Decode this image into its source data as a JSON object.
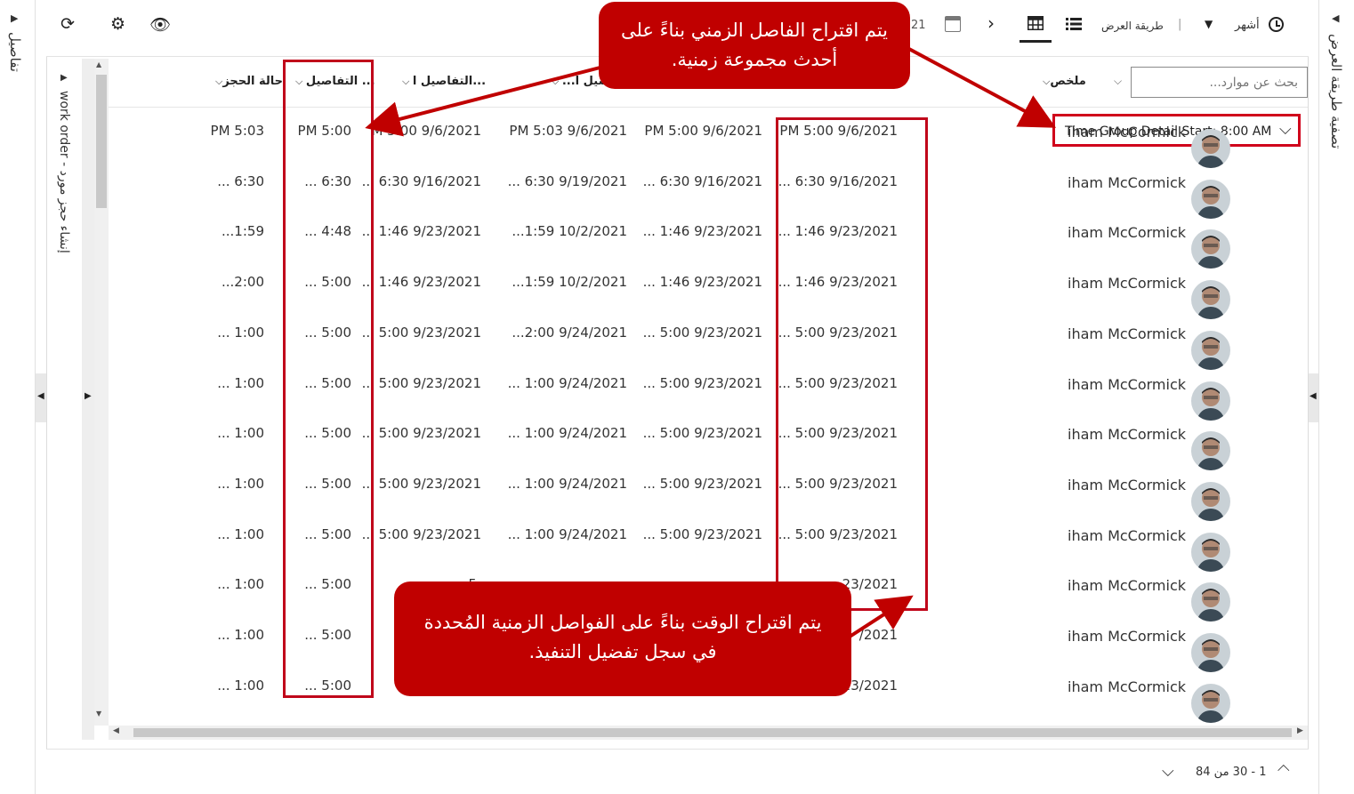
{
  "left_pane": {
    "label": "تفاصيل"
  },
  "right_pane": {
    "label": "تصفية طريقة العرض"
  },
  "strip": {
    "label": "work order - إنشاء حجز مورد"
  },
  "toolbar": {
    "period_label": "أشهر",
    "view_mode_label": "طريقة العرض",
    "separator": "|",
    "date_fragment": "21"
  },
  "search": {
    "placeholder": "بحث عن موارد..."
  },
  "summary_label": "ملخص",
  "time_group": {
    "label": "Time Group Detail Start: 8:00 AM"
  },
  "columns": {
    "status": "حالة الحجز",
    "details_a": "التفاصيل ...",
    "details_b": "التفاصيل ا...",
    "details_c": "...صيل ا"
  },
  "resource_name": "iham McCormick",
  "rows": [
    {
      "status": "PM 5:03",
      "d1": "PM 5:00",
      "d2": "M 5:00 9/6/2021",
      "d3": "PM 5:03 9/6/2021",
      "d4": "PM 5:00 9/6/2021",
      "d5": "PM 5:00 9/6/2021"
    },
    {
      "status": "... 6:30",
      "d1": "... 6:30",
      "d2": "... 6:30 9/16/2021",
      "d3": "... 6:30 9/19/2021",
      "d4": "... 6:30 9/16/2021",
      "d5": "... 6:30 9/16/2021"
    },
    {
      "status": "...1:59",
      "d1": "... 4:48",
      "d2": "... 1:46 9/23/2021",
      "d3": "...1:59 10/2/2021",
      "d4": "... 1:46 9/23/2021",
      "d5": "... 1:46 9/23/2021"
    },
    {
      "status": "...2:00",
      "d1": "... 5:00",
      "d2": "... 1:46 9/23/2021",
      "d3": "...1:59 10/2/2021",
      "d4": "... 1:46 9/23/2021",
      "d5": "... 1:46 9/23/2021"
    },
    {
      "status": "... 1:00",
      "d1": "... 5:00",
      "d2": "... 5:00 9/23/2021",
      "d3": "...2:00 9/24/2021",
      "d4": "... 5:00 9/23/2021",
      "d5": "... 5:00 9/23/2021"
    },
    {
      "status": "... 1:00",
      "d1": "... 5:00",
      "d2": "... 5:00 9/23/2021",
      "d3": "... 1:00 9/24/2021",
      "d4": "... 5:00 9/23/2021",
      "d5": "... 5:00 9/23/2021"
    },
    {
      "status": "... 1:00",
      "d1": "... 5:00",
      "d2": "... 5:00 9/23/2021",
      "d3": "... 1:00 9/24/2021",
      "d4": "... 5:00 9/23/2021",
      "d5": "... 5:00 9/23/2021"
    },
    {
      "status": "... 1:00",
      "d1": "... 5:00",
      "d2": "... 5:00 9/23/2021",
      "d3": "... 1:00 9/24/2021",
      "d4": "... 5:00 9/23/2021",
      "d5": "... 5:00 9/23/2021"
    },
    {
      "status": "... 1:00",
      "d1": "... 5:00",
      "d2": "... 5:00 9/23/2021",
      "d3": "... 1:00 9/24/2021",
      "d4": "... 5:00 9/23/2021",
      "d5": "... 5:00 9/23/2021"
    },
    {
      "status": "... 1:00",
      "d1": "... 5:00",
      "d2": "5:",
      "d3": "",
      "d4": "",
      "d5": "...23/2021"
    },
    {
      "status": "... 1:00",
      "d1": "... 5:00",
      "d2": "5",
      "d3": "",
      "d4": "",
      "d5": "/2021"
    },
    {
      "status": "... 1:00",
      "d1": "... 5:00",
      "d2": "5",
      "d3": "",
      "d4": "",
      "d5": "23/2021"
    }
  ],
  "callouts": {
    "top": "يتم اقتراح الفاصل الزمني بناءً على أحدث مجموعة زمنية.",
    "bottom": "يتم اقتراح الوقت بناءً على الفواصل الزمنية المُحددة في سجل تفضيل التنفيذ."
  },
  "footer": {
    "pager": "1 - 30 من 84"
  },
  "colors": {
    "accent_red": "#c00000",
    "box_red": "#c0061a"
  }
}
